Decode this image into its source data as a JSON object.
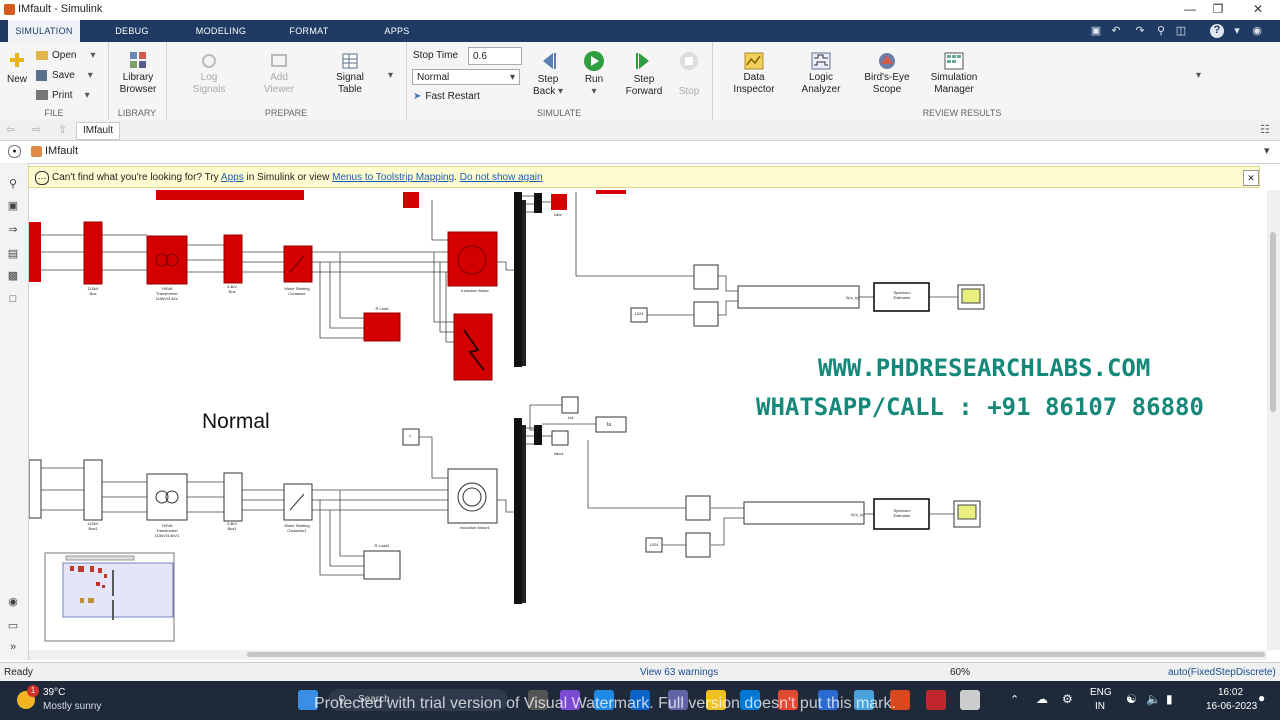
{
  "window": {
    "title": "IMfault - Simulink"
  },
  "tabs": [
    "SIMULATION",
    "DEBUG",
    "MODELING",
    "FORMAT",
    "APPS"
  ],
  "ribbon": {
    "file": {
      "new": "New",
      "open": "Open",
      "save": "Save",
      "print": "Print",
      "caption": "FILE"
    },
    "library": {
      "label1": "Library",
      "label2": "Browser",
      "caption": "LIBRARY"
    },
    "prepare": {
      "log1": "Log",
      "log2": "Signals",
      "add1": "Add",
      "add2": "Viewer",
      "sig1": "Signal",
      "sig2": "Table",
      "caption": "PREPARE"
    },
    "simulate": {
      "stop_time_label": "Stop Time",
      "stop_time_value": "0.6",
      "mode_value": "Normal",
      "fast_restart": "Fast Restart",
      "stepback1": "Step",
      "stepback2": "Back",
      "run": "Run",
      "stepfwd1": "Step",
      "stepfwd2": "Forward",
      "stop": "Stop",
      "caption": "SIMULATE"
    },
    "review": {
      "data1": "Data",
      "data2": "Inspector",
      "logic1": "Logic",
      "logic2": "Analyzer",
      "bird1": "Bird's-Eye",
      "bird2": "Scope",
      "simmgr1": "Simulation",
      "simmgr2": "Manager",
      "caption": "REVIEW RESULTS"
    }
  },
  "breadcrumb": {
    "tab": "IMfault",
    "path": "IMfault"
  },
  "notice": {
    "pre": "Can't find what you're looking for? Try ",
    "apps": "Apps",
    "mid": " in Simulink or view ",
    "menus": "Menus to Toolstrip Mapping",
    "dot": ". ",
    "dont": "Do not show again"
  },
  "diagram": {
    "normal_label": "Normal",
    "watermark_line1": "WWW.PHDRESEARCHLABS.COM",
    "watermark_line2": "WHATSAPP/CALL : +91 86107 86880",
    "top": {
      "bus115": "115kV\nBus",
      "transformer": "YMVA\nTransformer\n115kV/3.4kV",
      "bus34": "3.4kV\nBus",
      "contactor": "Motor Starting\nContactor",
      "rload": "R Load",
      "motor": "Induction Motor",
      "iabc": "Iabc",
      "spectrum": "Spectrum\nEstimator",
      "xk": "X(m_k)",
      "const": "1024"
    },
    "bottom": {
      "bus115": "115kV\nBus1",
      "transformer": "YMVA\nTransformer\n115kV/3.4kV1",
      "bus34": "3.4kV\nBus1",
      "contactor": "Motor Starting\nContactor1",
      "rload": "R Load1",
      "motor": "Induction Motor1",
      "iabc": "Iabc1",
      "ia": "Ia",
      "ia1": "Ia1",
      "one": "1",
      "spectrum": "Spectrum\nEstimator",
      "xk": "X(m_k)",
      "const": "1024"
    }
  },
  "status": {
    "ready": "Ready",
    "warnings": "View 63 warnings",
    "zoom": "60%",
    "solver": "auto(FixedStepDiscrete)"
  },
  "taskbar": {
    "temp": "39°C",
    "weather": "Mostly sunny",
    "search": "Search",
    "lang1": "ENG",
    "lang2": "IN",
    "time": "16:02",
    "date": "16-06-2023",
    "badge": "1",
    "overlay": "Protected with trial version of Visual Watermark. Full version doesn't put this mark."
  }
}
